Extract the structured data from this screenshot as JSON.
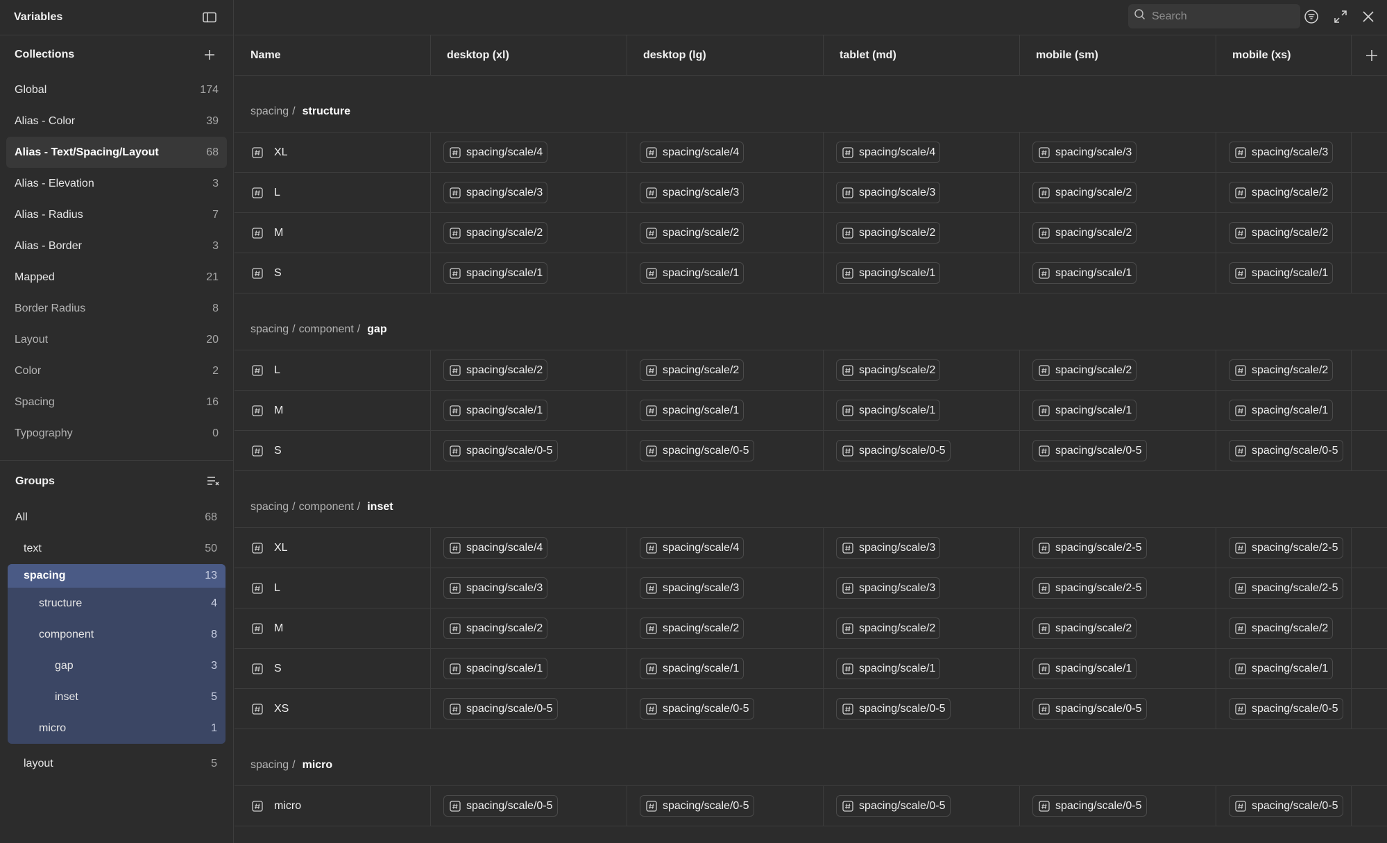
{
  "sidebar": {
    "title": "Variables",
    "collections_title": "Collections",
    "collections": [
      {
        "label": "Global",
        "count": "174"
      },
      {
        "label": "Alias - Color",
        "count": "39"
      },
      {
        "label": "Alias - Text/Spacing/Layout",
        "count": "68",
        "selected": true
      },
      {
        "label": "Alias - Elevation",
        "count": "3"
      },
      {
        "label": "Alias - Radius",
        "count": "7"
      },
      {
        "label": "Alias - Border",
        "count": "3"
      },
      {
        "label": "Mapped",
        "count": "21"
      },
      {
        "label": "Border Radius",
        "count": "8"
      },
      {
        "label": "Layout",
        "count": "20"
      },
      {
        "label": "Color",
        "count": "2"
      },
      {
        "label": "Spacing",
        "count": "16"
      },
      {
        "label": "Typography",
        "count": "0"
      }
    ],
    "groups_title": "Groups",
    "groups": {
      "all": {
        "label": "All",
        "count": "68"
      },
      "text": {
        "label": "text",
        "count": "50"
      },
      "spacing": {
        "label": "spacing",
        "count": "13"
      },
      "structure": {
        "label": "structure",
        "count": "4"
      },
      "component": {
        "label": "component",
        "count": "8"
      },
      "gap": {
        "label": "gap",
        "count": "3"
      },
      "inset": {
        "label": "inset",
        "count": "5"
      },
      "micro": {
        "label": "micro",
        "count": "1"
      },
      "layout": {
        "label": "layout",
        "count": "5"
      }
    }
  },
  "search": {
    "placeholder": "Search"
  },
  "columns": [
    "Name",
    "desktop (xl)",
    "desktop (lg)",
    "tablet (md)",
    "mobile (sm)",
    "mobile (xs)"
  ],
  "icons": {
    "sidebar_toggle": "sidebar-panel-icon",
    "add": "plus-icon",
    "groups_menu": "list-collapse-icon",
    "search": "search-icon",
    "filter": "filter-icon",
    "expand": "expand-icon",
    "close": "close-icon",
    "variable": "number-hash-icon"
  },
  "table_groups": [
    {
      "path": [
        "spacing"
      ],
      "leaf": "structure",
      "rows": [
        {
          "name": "XL",
          "values": [
            "spacing/scale/4",
            "spacing/scale/4",
            "spacing/scale/4",
            "spacing/scale/3",
            "spacing/scale/3"
          ]
        },
        {
          "name": "L",
          "values": [
            "spacing/scale/3",
            "spacing/scale/3",
            "spacing/scale/3",
            "spacing/scale/2",
            "spacing/scale/2"
          ]
        },
        {
          "name": "M",
          "values": [
            "spacing/scale/2",
            "spacing/scale/2",
            "spacing/scale/2",
            "spacing/scale/2",
            "spacing/scale/2"
          ]
        },
        {
          "name": "S",
          "values": [
            "spacing/scale/1",
            "spacing/scale/1",
            "spacing/scale/1",
            "spacing/scale/1",
            "spacing/scale/1"
          ]
        }
      ]
    },
    {
      "path": [
        "spacing",
        "component"
      ],
      "leaf": "gap",
      "rows": [
        {
          "name": "L",
          "values": [
            "spacing/scale/2",
            "spacing/scale/2",
            "spacing/scale/2",
            "spacing/scale/2",
            "spacing/scale/2"
          ]
        },
        {
          "name": "M",
          "values": [
            "spacing/scale/1",
            "spacing/scale/1",
            "spacing/scale/1",
            "spacing/scale/1",
            "spacing/scale/1"
          ]
        },
        {
          "name": "S",
          "values": [
            "spacing/scale/0-5",
            "spacing/scale/0-5",
            "spacing/scale/0-5",
            "spacing/scale/0-5",
            "spacing/scale/0-5"
          ]
        }
      ]
    },
    {
      "path": [
        "spacing",
        "component"
      ],
      "leaf": "inset",
      "rows": [
        {
          "name": "XL",
          "values": [
            "spacing/scale/4",
            "spacing/scale/4",
            "spacing/scale/3",
            "spacing/scale/2-5",
            "spacing/scale/2-5"
          ]
        },
        {
          "name": "L",
          "values": [
            "spacing/scale/3",
            "spacing/scale/3",
            "spacing/scale/3",
            "spacing/scale/2-5",
            "spacing/scale/2-5"
          ]
        },
        {
          "name": "M",
          "values": [
            "spacing/scale/2",
            "spacing/scale/2",
            "spacing/scale/2",
            "spacing/scale/2",
            "spacing/scale/2"
          ]
        },
        {
          "name": "S",
          "values": [
            "spacing/scale/1",
            "spacing/scale/1",
            "spacing/scale/1",
            "spacing/scale/1",
            "spacing/scale/1"
          ]
        },
        {
          "name": "XS",
          "values": [
            "spacing/scale/0-5",
            "spacing/scale/0-5",
            "spacing/scale/0-5",
            "spacing/scale/0-5",
            "spacing/scale/0-5"
          ]
        }
      ]
    },
    {
      "path": [
        "spacing"
      ],
      "leaf": "micro",
      "rows": [
        {
          "name": "micro",
          "values": [
            "spacing/scale/0-5",
            "spacing/scale/0-5",
            "spacing/scale/0-5",
            "spacing/scale/0-5",
            "spacing/scale/0-5"
          ]
        }
      ]
    }
  ],
  "colors": {
    "background": "#2c2c2c",
    "border": "#3d3d3d",
    "selected_collection": "#383838",
    "selected_group": "#4a5a85",
    "selected_group_children": "#3b4664"
  }
}
